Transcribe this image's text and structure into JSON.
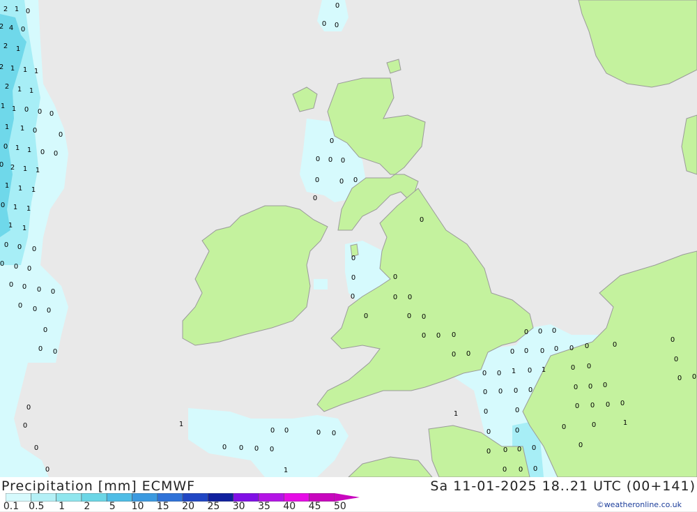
{
  "title": {
    "left": "Precipitation [mm] ECMWF",
    "right": "Sa 11-01-2025 18..21 UTC (00+141)"
  },
  "credit": "©weatheronline.co.uk",
  "legend": {
    "ticks": [
      "0.1",
      "0.5",
      "1",
      "2",
      "5",
      "10",
      "15",
      "20",
      "25",
      "30",
      "35",
      "40",
      "45",
      "50"
    ],
    "colors": [
      "#d6fafd",
      "#b4f0f6",
      "#90e6ee",
      "#6cd6e6",
      "#4fbde6",
      "#3b9ae0",
      "#2f72d8",
      "#2046c4",
      "#10209e",
      "#8010e6",
      "#b414e6",
      "#e60ce6",
      "#c806be"
    ]
  },
  "colors": {
    "sea": "#e9e9e9",
    "land": "#c4f29e",
    "precip_light": "#d6fafd",
    "precip_med": "#a7eef6",
    "precip_heavy": "#6fd8ea",
    "coast": "#9a9a9a"
  },
  "labels": [
    "2",
    "1",
    "0",
    "2",
    "4",
    "0",
    "2",
    "1",
    "2",
    "1",
    "1",
    "1",
    "2",
    "1",
    "1",
    "1",
    "1",
    "0",
    "0",
    "0",
    "1",
    "1",
    "0",
    "0",
    "0",
    "1",
    "1",
    "0",
    "0",
    "0",
    "2",
    "1",
    "1",
    "1",
    "1",
    "1",
    "0",
    "1",
    "1",
    "1",
    "1",
    "0",
    "0",
    "0",
    "0",
    "0",
    "0",
    "0",
    "0",
    "0",
    "0",
    "0",
    "0",
    "0",
    "0",
    "0",
    "0",
    "0",
    "0",
    "0",
    "0",
    "0",
    "0",
    "0",
    "0",
    "0",
    "0",
    "0",
    "0",
    "0",
    "0",
    "0",
    "0",
    "0",
    "0",
    "0",
    "0",
    "0",
    "0",
    "0",
    "0",
    "0",
    "0",
    "0",
    "0",
    "1",
    "0",
    "1",
    "0",
    "0",
    "0",
    "0",
    "0",
    "0",
    "0",
    "0",
    "0",
    "0",
    "0",
    "0",
    "0",
    "0",
    "0",
    "0",
    "0",
    "0",
    "0",
    "0",
    "0",
    "0",
    "0",
    "0",
    "0",
    "0",
    "0",
    "1",
    "0",
    "0",
    "0",
    "0",
    "0",
    "0",
    "1",
    "0",
    "0",
    "0",
    "0",
    "0",
    "0",
    "0",
    "0",
    "1",
    "0",
    "0",
    "0",
    "0",
    "0",
    "0",
    "0",
    "0",
    "0",
    "0",
    "0",
    "0",
    "1",
    "0",
    "1",
    "2",
    "1",
    "0",
    "0"
  ]
}
